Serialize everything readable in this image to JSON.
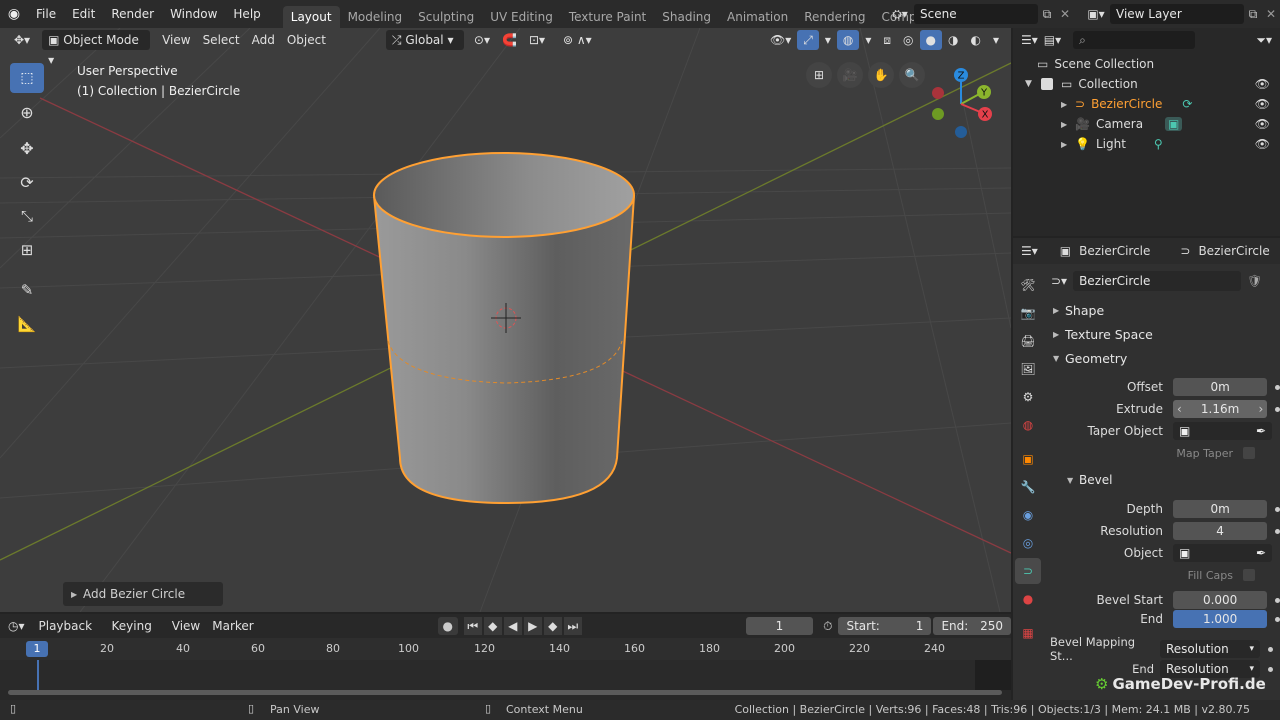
{
  "topbar": {
    "menus": [
      "File",
      "Edit",
      "Render",
      "Window",
      "Help"
    ],
    "workspaces": [
      "Layout",
      "Modeling",
      "Sculpting",
      "UV Editing",
      "Texture Paint",
      "Shading",
      "Animation",
      "Rendering",
      "Compositing"
    ],
    "active_workspace": "Layout",
    "scene": "Scene",
    "view_layer": "View Layer"
  },
  "viewport": {
    "mode": "Object Mode",
    "menus": [
      "View",
      "Select",
      "Add",
      "Object"
    ],
    "transform_orientation": "Global",
    "overlay_line1": "User Perspective",
    "overlay_line2": "(1) Collection | BezierCircle",
    "last_op": "Add Bezier Circle",
    "gizmo": {
      "x": "X",
      "y": "Y",
      "z": "Z"
    }
  },
  "outliner": {
    "search_placeholder": "",
    "root": "Scene Collection",
    "collection": "Collection",
    "items": [
      {
        "name": "BezierCircle",
        "selected": true
      },
      {
        "name": "Camera",
        "selected": false
      },
      {
        "name": "Light",
        "selected": false
      }
    ]
  },
  "properties": {
    "breadcrumb_object": "BezierCircle",
    "breadcrumb_data": "BezierCircle",
    "datablock_name": "BezierCircle",
    "panels": {
      "shape": "Shape",
      "texture_space": "Texture Space",
      "geometry": "Geometry",
      "bevel": "Bevel"
    },
    "offset_label": "Offset",
    "offset_value": "0m",
    "extrude_label": "Extrude",
    "extrude_value": "1.16m",
    "taper_label": "Taper Object",
    "map_taper_label": "Map Taper",
    "depth_label": "Depth",
    "depth_value": "0m",
    "resolution_label": "Resolution",
    "resolution_value": "4",
    "object_label": "Object",
    "fill_caps_label": "Fill Caps",
    "bevel_start_label": "Bevel Start",
    "bevel_start_value": "0.000",
    "end_label": "End",
    "end_value": "1.000",
    "bevel_mapping_label": "Bevel Mapping St...",
    "bevel_mapping_value": "Resolution",
    "end2_label": "End",
    "end2_value": "Resolution",
    "watermark": "GameDev-Profi.de"
  },
  "timeline": {
    "menus": [
      "Playback",
      "Keying",
      "View",
      "Marker"
    ],
    "current_frame": "1",
    "start_label": "Start:",
    "start_value": "1",
    "end_label": "End:",
    "end_value": "250",
    "ruler": [
      "1",
      "20",
      "40",
      "60",
      "80",
      "100",
      "120",
      "140",
      "160",
      "180",
      "200",
      "220",
      "240"
    ]
  },
  "statusbar": {
    "left_hint": "Pan View",
    "mid_hint": "Context Menu",
    "stats": "Collection | BezierCircle | Verts:96 | Faces:48 | Tris:96 | Objects:1/3 | Mem: 24.1 MB | v2.80.75"
  },
  "colors": {
    "accent": "#4772b3",
    "selection": "#ffa033",
    "x_axis": "#e5404b",
    "y_axis": "#8bb52d",
    "z_axis": "#2a8bdf"
  }
}
